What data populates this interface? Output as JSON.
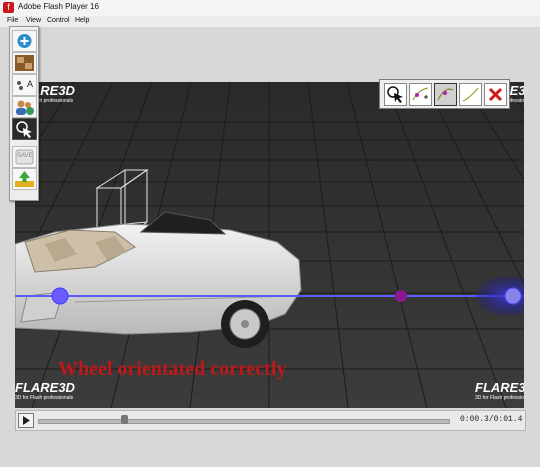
{
  "window": {
    "title": "Adobe Flash Player 16",
    "menu": [
      "File",
      "View",
      "Control",
      "Help"
    ]
  },
  "toolbox": {
    "tools": [
      {
        "name": "add-object-icon"
      },
      {
        "name": "texture-icon"
      },
      {
        "name": "text-tool-icon"
      },
      {
        "name": "users-icon"
      },
      {
        "name": "select-cursor-icon"
      },
      {
        "name": "save-icon",
        "label": "SAVE"
      },
      {
        "name": "upload-icon"
      }
    ]
  },
  "path_tools": [
    {
      "name": "select-tool-icon",
      "selected": false
    },
    {
      "name": "add-point-icon",
      "selected": false
    },
    {
      "name": "curve-tool-icon",
      "selected": true
    },
    {
      "name": "line-tool-icon",
      "selected": false
    },
    {
      "name": "delete-icon",
      "selected": false
    }
  ],
  "scene": {
    "caption": "Wheel orientated correctly",
    "logo_text": "FLARE3D",
    "logo_tagline": "3D for Flash professionals"
  },
  "player": {
    "time": "0:00.3/0:01.4",
    "progress": 0.21
  },
  "colors": {
    "caption": "#c01818",
    "path_line": "#5b5bff",
    "path_node": "#7a5cff",
    "midpoint": "#8a1a8a"
  }
}
